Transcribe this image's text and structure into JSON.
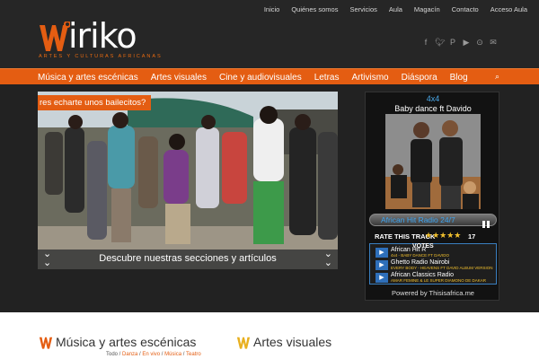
{
  "topnav": [
    "Inicio",
    "Quiénes somos",
    "Servicios",
    "Aula",
    "Magacín",
    "Contacto",
    "Acceso Aula"
  ],
  "logo": {
    "word": "iriko",
    "tagline": "ARTES Y CULTURAS AFRICANAS"
  },
  "social": [
    "facebook-icon",
    "twitter-icon",
    "pinterest-icon",
    "youtube-icon",
    "rss-icon",
    "mail-icon"
  ],
  "mainnav": [
    "Música y artes escénicas",
    "Artes visuales",
    "Cine y audiovisuales",
    "Letras",
    "Artivismo",
    "Diáspora",
    "Blog"
  ],
  "slider": {
    "caption": "res echarte unos bailecitos?",
    "bar_text": "Descubre nuestras secciones y artículos"
  },
  "radio": {
    "position": "4x4",
    "track": "Baby dance ft Davido",
    "station": "African Hit Radio 24/7",
    "rate_label": "RATE THIS TRACK",
    "stars": "★★★★★",
    "vote_count": "17",
    "votes_label": "VOTES",
    "rows": [
      {
        "name": "African Hit R",
        "sub": "4x4 - BABY DANCE FT DAVIDO"
      },
      {
        "name": "Ghetto Radio Nairobi",
        "sub": "EVERY BODY - HEAVENS FT DAVID ALBUM VERSION"
      },
      {
        "name": "African Classics Radio",
        "sub": "AMAR FEMINE & LE SUPER DIAMONO DE DAKAR"
      }
    ],
    "powered": "Powered by Thisisafrica.me"
  },
  "bottom": {
    "sec1": "Música y artes escénicas",
    "sec2": "Artes visuales",
    "subs": {
      "all": "Todo",
      "a": "Danza",
      "b": "En vivo",
      "c": "Música",
      "d": "Teatro",
      "sep": " / "
    }
  },
  "colors": {
    "accent": "#e45d12",
    "header_bg": "#262626",
    "radio_blue": "#3da4f0"
  }
}
